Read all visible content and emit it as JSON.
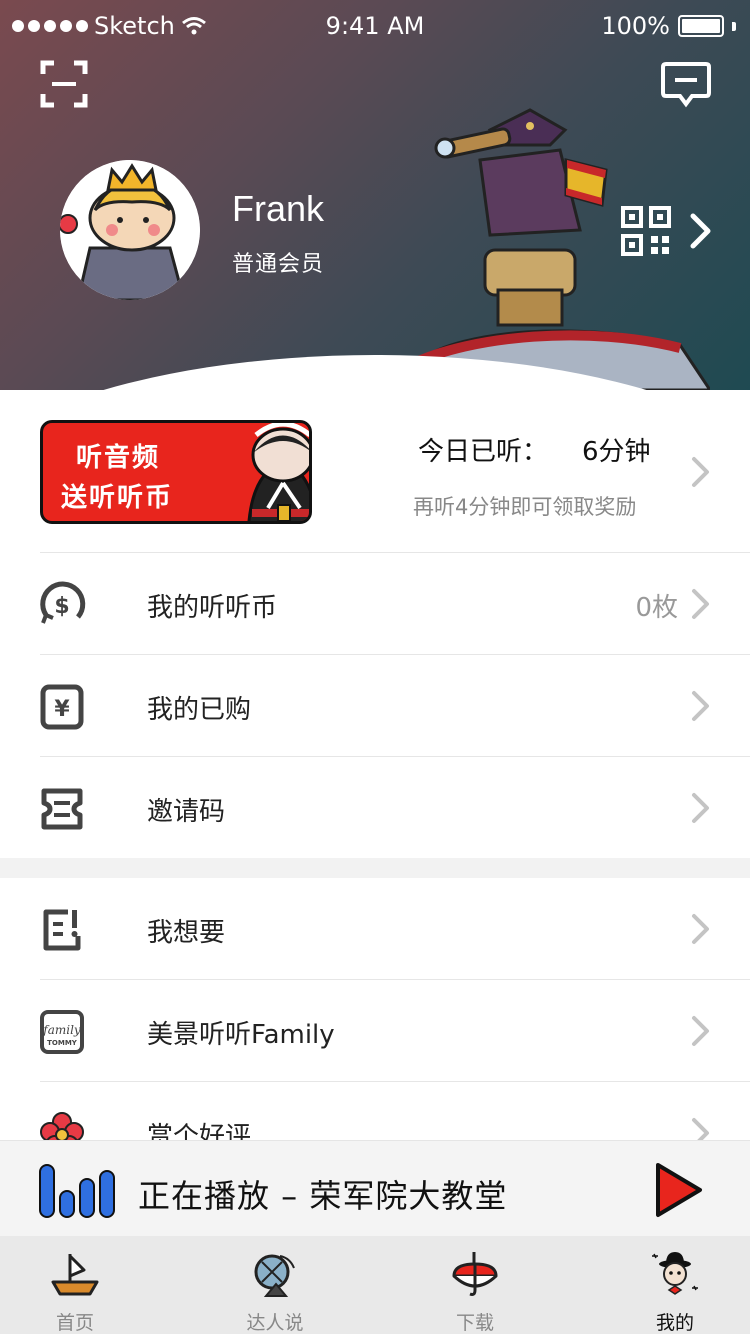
{
  "status_bar": {
    "carrier": "Sketch",
    "time": "9:41 AM",
    "battery": "100%"
  },
  "profile": {
    "name": "Frank",
    "membership": "普通会员"
  },
  "promo": {
    "banner_line1": "听音频",
    "banner_line2": "送听听币",
    "today_label": "今日已听：",
    "today_value": "6分钟",
    "hint": "再听4分钟即可领取奖励"
  },
  "menu": [
    {
      "label": "我的听听币",
      "value": "0枚",
      "icon": "coin-icon"
    },
    {
      "label": "我的已购",
      "value": "",
      "icon": "purchase-icon"
    },
    {
      "label": "邀请码",
      "value": "",
      "icon": "ticket-icon"
    },
    {
      "label": "我想要",
      "value": "",
      "icon": "wish-icon"
    },
    {
      "label": "美景听听Family",
      "value": "",
      "icon": "family-icon"
    },
    {
      "label": "赏个好评",
      "value": "",
      "icon": "flower-icon"
    }
  ],
  "player": {
    "now_playing": "正在播放 – 荣军院大教堂"
  },
  "tabs": [
    {
      "label": "首页",
      "icon": "boat-icon",
      "active": false
    },
    {
      "label": "达人说",
      "icon": "satellite-icon",
      "active": false
    },
    {
      "label": "下载",
      "icon": "umbrella-icon",
      "active": false
    },
    {
      "label": "我的",
      "icon": "profile-character-icon",
      "active": true
    }
  ],
  "colors": {
    "accent_red": "#e8251d",
    "accent_blue": "#2f6fe0"
  }
}
